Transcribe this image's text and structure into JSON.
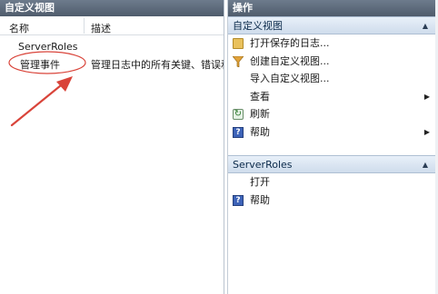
{
  "left": {
    "title": "自定义视图",
    "columns": {
      "name": "名称",
      "desc": "描述"
    },
    "rows": [
      {
        "name": "ServerRoles",
        "desc": ""
      },
      {
        "name": "管理事件",
        "desc": "管理日志中的所有关键、错误和警"
      }
    ]
  },
  "right": {
    "title": "操作",
    "section1": {
      "label": "自定义视图",
      "items": [
        {
          "label": "打开保存的日志...",
          "icon": "folder-icon"
        },
        {
          "label": "创建自定义视图...",
          "icon": "filter-icon"
        },
        {
          "label": "导入自定义视图...",
          "icon": ""
        },
        {
          "label": "查看",
          "icon": "",
          "submenu": true
        },
        {
          "label": "刷新",
          "icon": "refresh-icon"
        },
        {
          "label": "帮助",
          "icon": "help-icon",
          "submenu": true
        }
      ]
    },
    "section2": {
      "label": "ServerRoles",
      "items": [
        {
          "label": "打开",
          "icon": ""
        },
        {
          "label": "帮助",
          "icon": "help-icon"
        }
      ]
    }
  },
  "colors": {
    "title_bar": "#5a6778",
    "section_header": "#d8e4f1",
    "annotation": "#d9443a"
  }
}
